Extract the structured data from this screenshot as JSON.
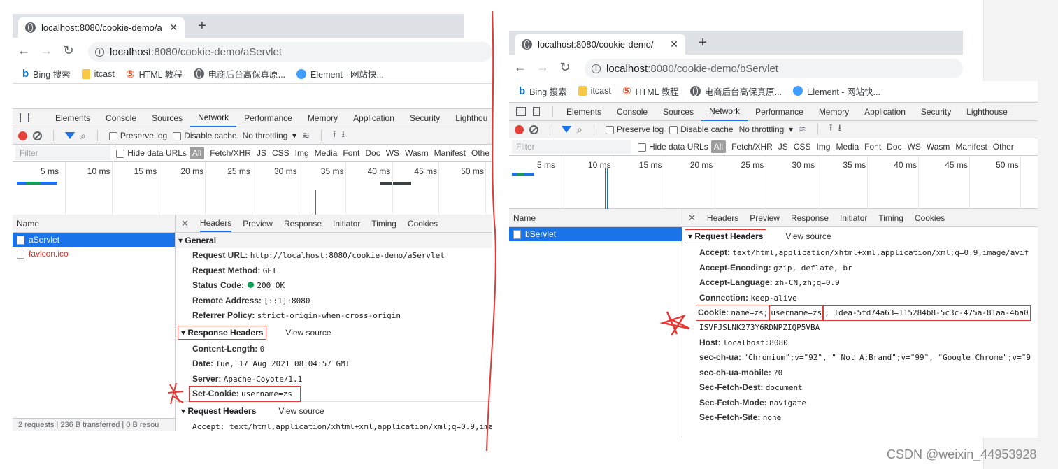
{
  "watermark": "CSDN @weixin_44953928",
  "left": {
    "tab_title": "localhost:8080/cookie-demo/a",
    "url_host": "localhost",
    "url_path": ":8080/cookie-demo/aServlet",
    "bookmarks": [
      "Bing 搜索",
      "itcast",
      "HTML 教程",
      "电商后台高保真原...",
      "Element - 网站快..."
    ],
    "devtools_tabs": [
      "Elements",
      "Console",
      "Sources",
      "Network",
      "Performance",
      "Memory",
      "Application",
      "Security",
      "Lighthou"
    ],
    "net_toolbar": {
      "preserve_log": "Preserve log",
      "disable_cache": "Disable cache",
      "throttling": "No throttling"
    },
    "filter": {
      "placeholder": "Filter",
      "hide_data_urls": "Hide data URLs",
      "types": [
        "All",
        "Fetch/XHR",
        "JS",
        "CSS",
        "Img",
        "Media",
        "Font",
        "Doc",
        "WS",
        "Wasm",
        "Manifest",
        "Othe"
      ]
    },
    "ticks": [
      "5 ms",
      "10 ms",
      "15 ms",
      "20 ms",
      "25 ms",
      "30 ms",
      "35 ms",
      "40 ms",
      "45 ms",
      "50 ms"
    ],
    "name_header": "Name",
    "requests": [
      "aServlet",
      "favicon.ico"
    ],
    "status": "2 requests  |  236 B transferred  |  0 B resou",
    "detail_tabs": [
      "Headers",
      "Preview",
      "Response",
      "Initiator",
      "Timing",
      "Cookies"
    ],
    "general_title": "General",
    "general": [
      {
        "k": "Request URL:",
        "v": "http://localhost:8080/cookie-demo/aServlet"
      },
      {
        "k": "Request Method:",
        "v": "GET"
      },
      {
        "k": "Status Code:",
        "v": "200 OK"
      },
      {
        "k": "Remote Address:",
        "v": "[::1]:8080"
      },
      {
        "k": "Referrer Policy:",
        "v": "strict-origin-when-cross-origin"
      }
    ],
    "response_headers_title": "Response Headers",
    "view_source": "View source",
    "response_headers": [
      {
        "k": "Content-Length:",
        "v": "0"
      },
      {
        "k": "Date:",
        "v": "Tue, 17 Aug 2021 08:04:57 GMT"
      },
      {
        "k": "Server:",
        "v": "Apache-Coyote/1.1"
      },
      {
        "k": "Set-Cookie:",
        "v": "username=zs"
      }
    ],
    "request_headers_title": "Request Headers",
    "request_partial": "Accept: text/html,application/xhtml+xml,application/xml;q=0.9,image/"
  },
  "right": {
    "tab_title": "localhost:8080/cookie-demo/",
    "url_host": "localhost",
    "url_path": ":8080/cookie-demo/bServlet",
    "bookmarks": [
      "Bing 搜索",
      "itcast",
      "HTML 教程",
      "电商后台高保真原...",
      "Element - 网站快..."
    ],
    "devtools_tabs": [
      "Elements",
      "Console",
      "Sources",
      "Network",
      "Performance",
      "Memory",
      "Application",
      "Security",
      "Lighthouse"
    ],
    "net_toolbar": {
      "preserve_log": "Preserve log",
      "disable_cache": "Disable cache",
      "throttling": "No throttling"
    },
    "filter": {
      "placeholder": "Filter",
      "hide_data_urls": "Hide data URLs",
      "types": [
        "All",
        "Fetch/XHR",
        "JS",
        "CSS",
        "Img",
        "Media",
        "Font",
        "Doc",
        "WS",
        "Wasm",
        "Manifest",
        "Other"
      ]
    },
    "ticks": [
      "5 ms",
      "10 ms",
      "15 ms",
      "20 ms",
      "25 ms",
      "30 ms",
      "35 ms",
      "40 ms",
      "45 ms",
      "50 ms"
    ],
    "name_header": "Name",
    "requests": [
      "bServlet"
    ],
    "detail_tabs": [
      "Headers",
      "Preview",
      "Response",
      "Initiator",
      "Timing",
      "Cookies"
    ],
    "request_headers_title": "Request Headers",
    "view_source": "View source",
    "request_headers": [
      {
        "k": "Accept:",
        "v": "text/html,application/xhtml+xml,application/xml;q=0.9,image/avif"
      },
      {
        "k": "Accept-Encoding:",
        "v": "gzip, deflate, br"
      },
      {
        "k": "Accept-Language:",
        "v": "zh-CN,zh;q=0.9"
      },
      {
        "k": "Connection:",
        "v": "keep-alive"
      }
    ],
    "cookie": {
      "k": "Cookie:",
      "v1": "name=zs;",
      "v2": "username=zs",
      "v3": "; Idea-5fd74a63=115284b8-5c3c-475a-81aa-4ba0",
      "cont": "ISVFJSLNK273Y6RDNPZIQP5VBA"
    },
    "request_headers_more": [
      {
        "k": "Host:",
        "v": "localhost:8080"
      },
      {
        "k": "sec-ch-ua:",
        "v": "\"Chromium\";v=\"92\", \" Not A;Brand\";v=\"99\", \"Google Chrome\";v=\"9"
      },
      {
        "k": "sec-ch-ua-mobile:",
        "v": "?0"
      },
      {
        "k": "Sec-Fetch-Dest:",
        "v": "document"
      },
      {
        "k": "Sec-Fetch-Mode:",
        "v": "navigate"
      },
      {
        "k": "Sec-Fetch-Site:",
        "v": "none"
      }
    ]
  }
}
